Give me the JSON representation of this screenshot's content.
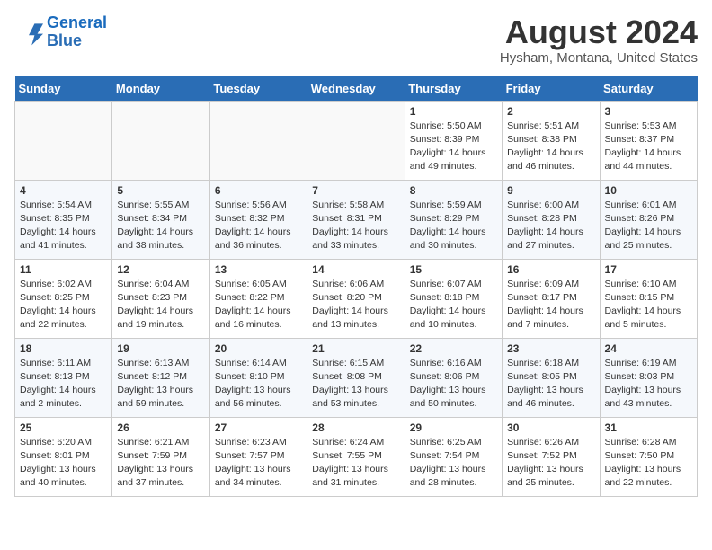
{
  "header": {
    "logo_line1": "General",
    "logo_line2": "Blue",
    "main_title": "August 2024",
    "subtitle": "Hysham, Montana, United States"
  },
  "weekdays": [
    "Sunday",
    "Monday",
    "Tuesday",
    "Wednesday",
    "Thursday",
    "Friday",
    "Saturday"
  ],
  "weeks": [
    [
      {
        "day": "",
        "info": ""
      },
      {
        "day": "",
        "info": ""
      },
      {
        "day": "",
        "info": ""
      },
      {
        "day": "",
        "info": ""
      },
      {
        "day": "1",
        "info": "Sunrise: 5:50 AM\nSunset: 8:39 PM\nDaylight: 14 hours\nand 49 minutes."
      },
      {
        "day": "2",
        "info": "Sunrise: 5:51 AM\nSunset: 8:38 PM\nDaylight: 14 hours\nand 46 minutes."
      },
      {
        "day": "3",
        "info": "Sunrise: 5:53 AM\nSunset: 8:37 PM\nDaylight: 14 hours\nand 44 minutes."
      }
    ],
    [
      {
        "day": "4",
        "info": "Sunrise: 5:54 AM\nSunset: 8:35 PM\nDaylight: 14 hours\nand 41 minutes."
      },
      {
        "day": "5",
        "info": "Sunrise: 5:55 AM\nSunset: 8:34 PM\nDaylight: 14 hours\nand 38 minutes."
      },
      {
        "day": "6",
        "info": "Sunrise: 5:56 AM\nSunset: 8:32 PM\nDaylight: 14 hours\nand 36 minutes."
      },
      {
        "day": "7",
        "info": "Sunrise: 5:58 AM\nSunset: 8:31 PM\nDaylight: 14 hours\nand 33 minutes."
      },
      {
        "day": "8",
        "info": "Sunrise: 5:59 AM\nSunset: 8:29 PM\nDaylight: 14 hours\nand 30 minutes."
      },
      {
        "day": "9",
        "info": "Sunrise: 6:00 AM\nSunset: 8:28 PM\nDaylight: 14 hours\nand 27 minutes."
      },
      {
        "day": "10",
        "info": "Sunrise: 6:01 AM\nSunset: 8:26 PM\nDaylight: 14 hours\nand 25 minutes."
      }
    ],
    [
      {
        "day": "11",
        "info": "Sunrise: 6:02 AM\nSunset: 8:25 PM\nDaylight: 14 hours\nand 22 minutes."
      },
      {
        "day": "12",
        "info": "Sunrise: 6:04 AM\nSunset: 8:23 PM\nDaylight: 14 hours\nand 19 minutes."
      },
      {
        "day": "13",
        "info": "Sunrise: 6:05 AM\nSunset: 8:22 PM\nDaylight: 14 hours\nand 16 minutes."
      },
      {
        "day": "14",
        "info": "Sunrise: 6:06 AM\nSunset: 8:20 PM\nDaylight: 14 hours\nand 13 minutes."
      },
      {
        "day": "15",
        "info": "Sunrise: 6:07 AM\nSunset: 8:18 PM\nDaylight: 14 hours\nand 10 minutes."
      },
      {
        "day": "16",
        "info": "Sunrise: 6:09 AM\nSunset: 8:17 PM\nDaylight: 14 hours\nand 7 minutes."
      },
      {
        "day": "17",
        "info": "Sunrise: 6:10 AM\nSunset: 8:15 PM\nDaylight: 14 hours\nand 5 minutes."
      }
    ],
    [
      {
        "day": "18",
        "info": "Sunrise: 6:11 AM\nSunset: 8:13 PM\nDaylight: 14 hours\nand 2 minutes."
      },
      {
        "day": "19",
        "info": "Sunrise: 6:13 AM\nSunset: 8:12 PM\nDaylight: 13 hours\nand 59 minutes."
      },
      {
        "day": "20",
        "info": "Sunrise: 6:14 AM\nSunset: 8:10 PM\nDaylight: 13 hours\nand 56 minutes."
      },
      {
        "day": "21",
        "info": "Sunrise: 6:15 AM\nSunset: 8:08 PM\nDaylight: 13 hours\nand 53 minutes."
      },
      {
        "day": "22",
        "info": "Sunrise: 6:16 AM\nSunset: 8:06 PM\nDaylight: 13 hours\nand 50 minutes."
      },
      {
        "day": "23",
        "info": "Sunrise: 6:18 AM\nSunset: 8:05 PM\nDaylight: 13 hours\nand 46 minutes."
      },
      {
        "day": "24",
        "info": "Sunrise: 6:19 AM\nSunset: 8:03 PM\nDaylight: 13 hours\nand 43 minutes."
      }
    ],
    [
      {
        "day": "25",
        "info": "Sunrise: 6:20 AM\nSunset: 8:01 PM\nDaylight: 13 hours\nand 40 minutes."
      },
      {
        "day": "26",
        "info": "Sunrise: 6:21 AM\nSunset: 7:59 PM\nDaylight: 13 hours\nand 37 minutes."
      },
      {
        "day": "27",
        "info": "Sunrise: 6:23 AM\nSunset: 7:57 PM\nDaylight: 13 hours\nand 34 minutes."
      },
      {
        "day": "28",
        "info": "Sunrise: 6:24 AM\nSunset: 7:55 PM\nDaylight: 13 hours\nand 31 minutes."
      },
      {
        "day": "29",
        "info": "Sunrise: 6:25 AM\nSunset: 7:54 PM\nDaylight: 13 hours\nand 28 minutes."
      },
      {
        "day": "30",
        "info": "Sunrise: 6:26 AM\nSunset: 7:52 PM\nDaylight: 13 hours\nand 25 minutes."
      },
      {
        "day": "31",
        "info": "Sunrise: 6:28 AM\nSunset: 7:50 PM\nDaylight: 13 hours\nand 22 minutes."
      }
    ]
  ]
}
